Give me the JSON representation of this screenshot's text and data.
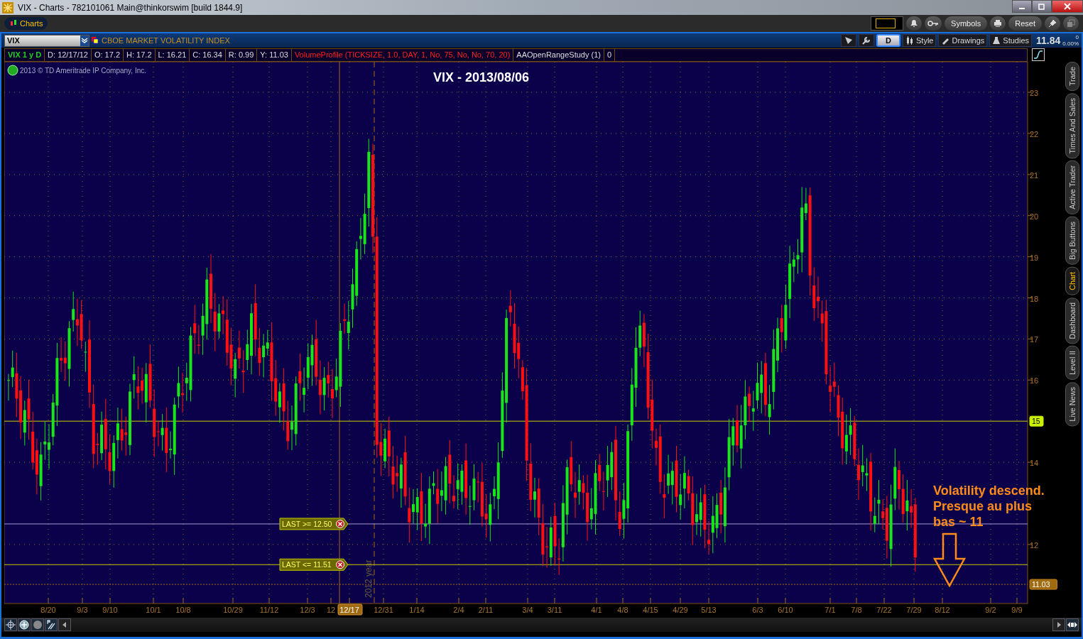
{
  "window": {
    "title": "VIX - Charts - 782101061 Main@thinkorswim [build 1844.9]"
  },
  "toolbar": {
    "tabs": [
      {
        "label": "Charts",
        "selected": true
      }
    ],
    "buttons": [
      "Symbols",
      "Reset"
    ]
  },
  "chart_header": {
    "symbol": "VIX",
    "description": "CBOE MARKET VOLATILITY INDEX",
    "aggregation": "D",
    "tools": [
      "Style",
      "Drawings",
      "Studies"
    ],
    "last": "11.84",
    "change": "0",
    "change_pct": "0.00%"
  },
  "info_bar": [
    {
      "text": "VIX 1 y D",
      "kind": "symbol"
    },
    {
      "text": "D: 12/17/12",
      "kind": "value"
    },
    {
      "text": "O: 17.2",
      "kind": "value"
    },
    {
      "text": "H: 17.2",
      "kind": "value"
    },
    {
      "text": "L: 16.21",
      "kind": "value"
    },
    {
      "text": "C: 16.34",
      "kind": "value"
    },
    {
      "text": "R: 0.99",
      "kind": "value"
    },
    {
      "text": "Y: 11.03",
      "kind": "value"
    },
    {
      "text": "VolumeProfile (TICKSIZE, 1.0, DAY, 1, No, 75, No, No, 70, 20)",
      "kind": "study_alert"
    },
    {
      "text": "AAOpenRangeStudy (1)",
      "kind": "study"
    },
    {
      "text": "0",
      "kind": "value"
    }
  ],
  "copyright": "2013 © TD Ameritrade IP Company, Inc.",
  "chart_title": "VIX - 2013/08/06",
  "note": [
    "Volatility descend.",
    "Presque au plus",
    "bas ~ 11"
  ],
  "price_ticks": [
    "23",
    "22",
    "21",
    "20",
    "19",
    "18",
    "17",
    "16",
    "14",
    "12"
  ],
  "price_labels": [
    {
      "text": "15",
      "kind": "level"
    },
    {
      "text": "11.03",
      "kind": "last"
    }
  ],
  "alerts": [
    {
      "label": "LAST >= 12.50",
      "kind": "above"
    },
    {
      "label": "LAST <= 11.51",
      "kind": "below"
    }
  ],
  "year_marker": "2012 year",
  "date_ticks": [
    {
      "text": "8/20",
      "selected": false
    },
    {
      "text": "9/3",
      "selected": false
    },
    {
      "text": "9/10",
      "selected": false
    },
    {
      "text": "10/1",
      "selected": false
    },
    {
      "text": "10/8",
      "selected": false
    },
    {
      "text": "10/29",
      "selected": false
    },
    {
      "text": "11/12",
      "selected": false
    },
    {
      "text": "12/3",
      "selected": false
    },
    {
      "text": "12",
      "selected": false
    },
    {
      "text": "12/17",
      "selected": true
    },
    {
      "text": "12/31",
      "selected": false
    },
    {
      "text": "1/14",
      "selected": false
    },
    {
      "text": "2/4",
      "selected": false
    },
    {
      "text": "2/11",
      "selected": false
    },
    {
      "text": "3/4",
      "selected": false
    },
    {
      "text": "3/11",
      "selected": false
    },
    {
      "text": "4/1",
      "selected": false
    },
    {
      "text": "4/8",
      "selected": false
    },
    {
      "text": "4/15",
      "selected": false
    },
    {
      "text": "4/29",
      "selected": false
    },
    {
      "text": "5/13",
      "selected": false
    },
    {
      "text": "6/3",
      "selected": false
    },
    {
      "text": "6/10",
      "selected": false
    },
    {
      "text": "7/1",
      "selected": false
    },
    {
      "text": "7/8",
      "selected": false
    },
    {
      "text": "7/22",
      "selected": false
    },
    {
      "text": "7/29",
      "selected": false
    },
    {
      "text": "8/12",
      "selected": false
    },
    {
      "text": "9/2",
      "selected": false
    },
    {
      "text": "9/9",
      "selected": false
    }
  ],
  "side_tabs": [
    {
      "label": "Trade",
      "selected": false
    },
    {
      "label": "Times And Sales",
      "selected": false
    },
    {
      "label": "Active Trader",
      "selected": false
    },
    {
      "label": "Big Buttons",
      "selected": false
    },
    {
      "label": "Chart",
      "selected": true
    },
    {
      "label": "Dashboard",
      "selected": false
    },
    {
      "label": "Level II",
      "selected": false
    },
    {
      "label": "Live News",
      "selected": false
    }
  ]
}
